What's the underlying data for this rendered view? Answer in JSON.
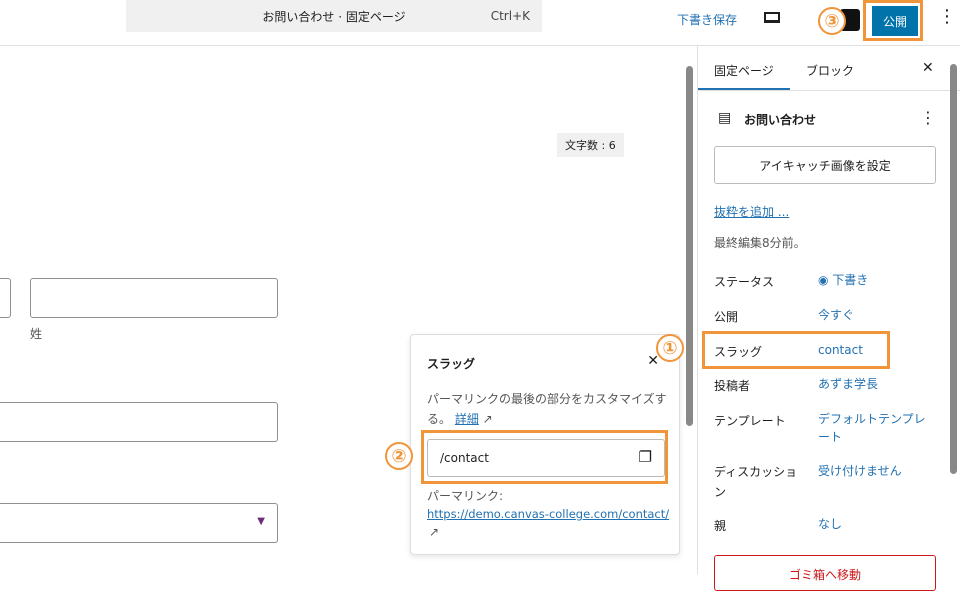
{
  "header": {
    "command_text": "お問い合わせ · 固定ページ",
    "shortcut": "Ctrl+K",
    "save_draft": "下書き保存",
    "publish": "公開"
  },
  "canvas": {
    "word_count": "文字数 : 6",
    "last_name_label": "姓"
  },
  "sidebar": {
    "tabs": [
      "固定ページ",
      "ブロック"
    ],
    "page_title": "お問い合わせ",
    "featured_image": "アイキャッチ画像を設定",
    "add_excerpt": "抜粋を追加 ...",
    "last_edited": "最終編集8分前。",
    "rows": [
      {
        "label": "ステータス",
        "value": "下書き"
      },
      {
        "label": "公開",
        "value": "今すぐ"
      },
      {
        "label": "スラッグ",
        "value": "contact"
      },
      {
        "label": "投稿者",
        "value": "あずま学長"
      },
      {
        "label": "テンプレート",
        "value": "デフォルトテンプレート"
      },
      {
        "label": "ディスカッション",
        "value": "受け付けません"
      },
      {
        "label": "親",
        "value": "なし"
      }
    ],
    "trash": "ゴミ箱へ移動"
  },
  "slug_popover": {
    "title": "スラッグ",
    "description": "パーマリンクの最後の部分をカスタマイズする。",
    "details_link": "詳細",
    "slug_value": "/contact",
    "permalink_label": "パーマリンク:",
    "permalink_url": "https://demo.canvas-college.com/contact/"
  },
  "annotations": [
    "①",
    "②",
    "③"
  ]
}
